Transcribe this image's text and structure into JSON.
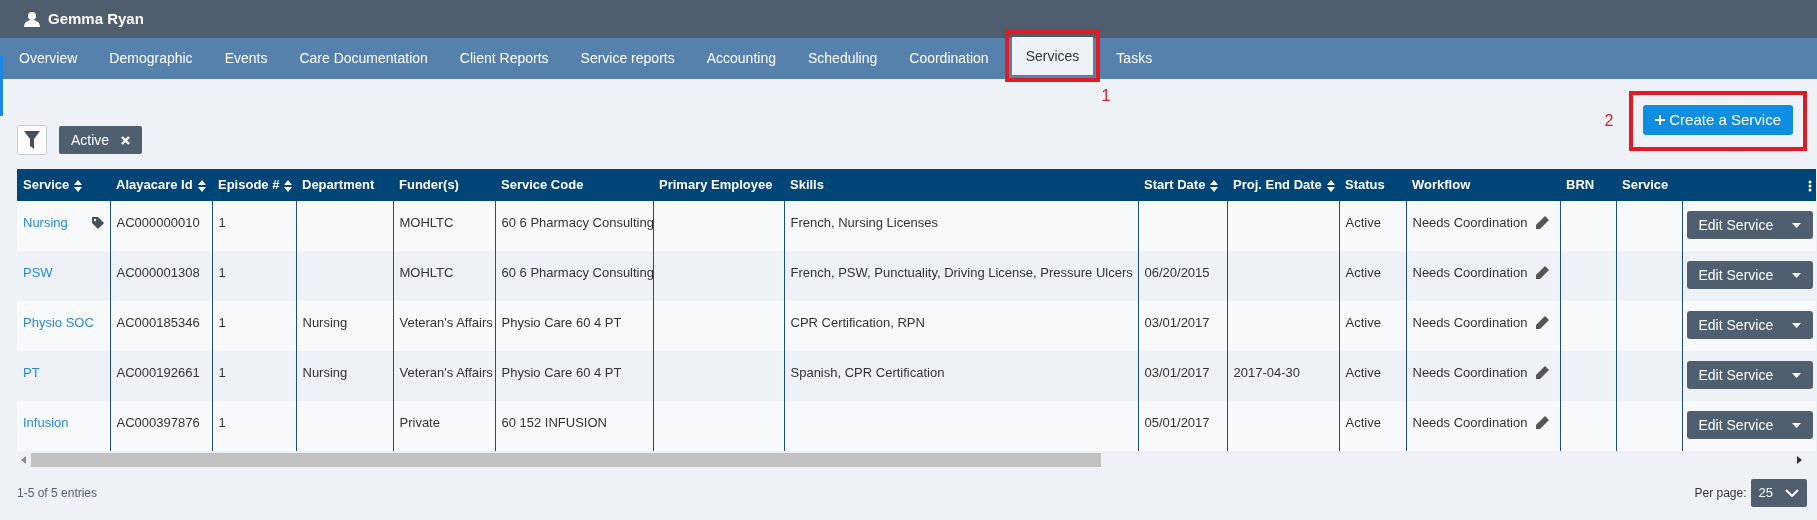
{
  "header": {
    "user_name": "Gemma Ryan"
  },
  "tabs": [
    {
      "label": "Overview",
      "selected": false
    },
    {
      "label": "Demographic",
      "selected": false
    },
    {
      "label": "Events",
      "selected": false
    },
    {
      "label": "Care Documentation",
      "selected": false
    },
    {
      "label": "Client Reports",
      "selected": false
    },
    {
      "label": "Service reports",
      "selected": false
    },
    {
      "label": "Accounting",
      "selected": false
    },
    {
      "label": "Scheduling",
      "selected": false
    },
    {
      "label": "Coordination",
      "selected": false
    },
    {
      "label": "Services",
      "selected": true,
      "callout": "1"
    },
    {
      "label": "Tasks",
      "selected": false
    }
  ],
  "create_button": {
    "label": "Create a Service",
    "callout": "2"
  },
  "filters": [
    {
      "label": "Active"
    }
  ],
  "table": {
    "columns": [
      {
        "label": "Service",
        "sortable": true
      },
      {
        "label": "Alayacare Id",
        "sortable": true
      },
      {
        "label": "Episode #",
        "sortable": true
      },
      {
        "label": "Department",
        "sortable": false
      },
      {
        "label": "Funder(s)",
        "sortable": false
      },
      {
        "label": "Service Code",
        "sortable": false
      },
      {
        "label": "Primary Employee",
        "sortable": false
      },
      {
        "label": "Skills",
        "sortable": false
      },
      {
        "label": "Start Date",
        "sortable": true
      },
      {
        "label": "Proj. End Date",
        "sortable": true
      },
      {
        "label": "Status",
        "sortable": false
      },
      {
        "label": "Workflow",
        "sortable": false
      },
      {
        "label": "BRN",
        "sortable": false
      },
      {
        "label": "Service",
        "sortable": false
      }
    ],
    "rows": [
      {
        "service": "Nursing",
        "tagged": true,
        "id": "AC000000010",
        "episode": "1",
        "department": "",
        "funders": "MOHLTC",
        "code": "60 6 Pharmacy Consulting",
        "employee": "",
        "skills": "French, Nursing Licenses",
        "start": "",
        "end": "",
        "status": "Active",
        "workflow": "Needs Coordination",
        "action": "Edit Service"
      },
      {
        "service": "PSW",
        "tagged": false,
        "id": "AC000001308",
        "episode": "1",
        "department": "",
        "funders": "MOHLTC",
        "code": "60 6 Pharmacy Consulting",
        "employee": "",
        "skills": "French, PSW, Punctuality, Driving License, Pressure Ulcers",
        "start": "06/20/2015",
        "end": "",
        "status": "Active",
        "workflow": "Needs Coordination",
        "action": "Edit Service"
      },
      {
        "service": "Physio SOC",
        "tagged": false,
        "id": "AC000185346",
        "episode": "1",
        "department": "Nursing",
        "funders": "Veteran's Affairs",
        "code": "Physio Care 60 4 PT",
        "employee": "",
        "skills": "CPR Certification, RPN",
        "start": "03/01/2017",
        "end": "",
        "status": "Active",
        "workflow": "Needs Coordination",
        "action": "Edit Service"
      },
      {
        "service": "PT",
        "tagged": false,
        "id": "AC000192661",
        "episode": "1",
        "department": "Nursing",
        "funders": "Veteran's Affairs",
        "code": "Physio Care 60 4 PT",
        "employee": "",
        "skills": "Spanish, CPR Certification",
        "start": "03/01/2017",
        "end": "2017-04-30",
        "status": "Active",
        "workflow": "Needs Coordination",
        "action": "Edit Service"
      },
      {
        "service": "Infusion",
        "tagged": false,
        "id": "AC000397876",
        "episode": "1",
        "department": "",
        "funders": "Private",
        "code": "60 152 INFUSION",
        "employee": "",
        "skills": "",
        "start": "05/01/2017",
        "end": "",
        "status": "Active",
        "workflow": "Needs Coordination",
        "action": "Edit Service"
      }
    ]
  },
  "footer": {
    "entries": "1-5 of 5 entries",
    "per_page_label": "Per page:",
    "per_page": "25"
  }
}
